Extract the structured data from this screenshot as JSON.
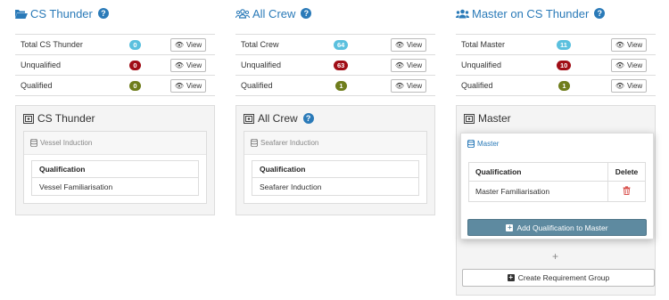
{
  "colors": {
    "accent": "#2a7ab8",
    "badge_info": "#5bc0de",
    "badge_danger": "#a00d16",
    "badge_olive": "#6f7d1c",
    "primary_btn": "#5e8aa0",
    "trash": "#d9534f"
  },
  "columns": [
    {
      "title": "CS Thunder",
      "icon": "folder-open-icon",
      "stats": [
        {
          "label": "Total CS Thunder",
          "count": "0",
          "view": "View"
        },
        {
          "label": "Unqualified",
          "count": "0",
          "view": "View"
        },
        {
          "label": "Qualified",
          "count": "0",
          "view": "View"
        }
      ],
      "panel": {
        "title": "CS Thunder",
        "group": "Vessel Induction",
        "table_header": "Qualification",
        "rows": [
          "Vessel Familiarisation"
        ]
      }
    },
    {
      "title": "All Crew",
      "icon": "users-icon",
      "stats": [
        {
          "label": "Total Crew",
          "count": "64",
          "view": "View"
        },
        {
          "label": "Unqualified",
          "count": "63",
          "view": "View"
        },
        {
          "label": "Qualified",
          "count": "1",
          "view": "View"
        }
      ],
      "panel": {
        "title": "All Crew",
        "group": "Seafarer Induction",
        "table_header": "Qualification",
        "rows": [
          "Seafarer Induction"
        ]
      }
    },
    {
      "title": "Master on CS Thunder",
      "icon": "user-group-icon",
      "stats": [
        {
          "label": "Total Master",
          "count": "11",
          "view": "View"
        },
        {
          "label": "Unqualified",
          "count": "10",
          "view": "View"
        },
        {
          "label": "Qualified",
          "count": "1",
          "view": "View"
        }
      ],
      "panel": {
        "title": "Master",
        "group": "Master",
        "table_header": "Qualification",
        "delete_header": "Delete",
        "rows": [
          "Master Familiarisation"
        ],
        "add_button": "Add Qualification to Master",
        "plus": "+",
        "create_button": "Create Requirement Group"
      }
    }
  ]
}
